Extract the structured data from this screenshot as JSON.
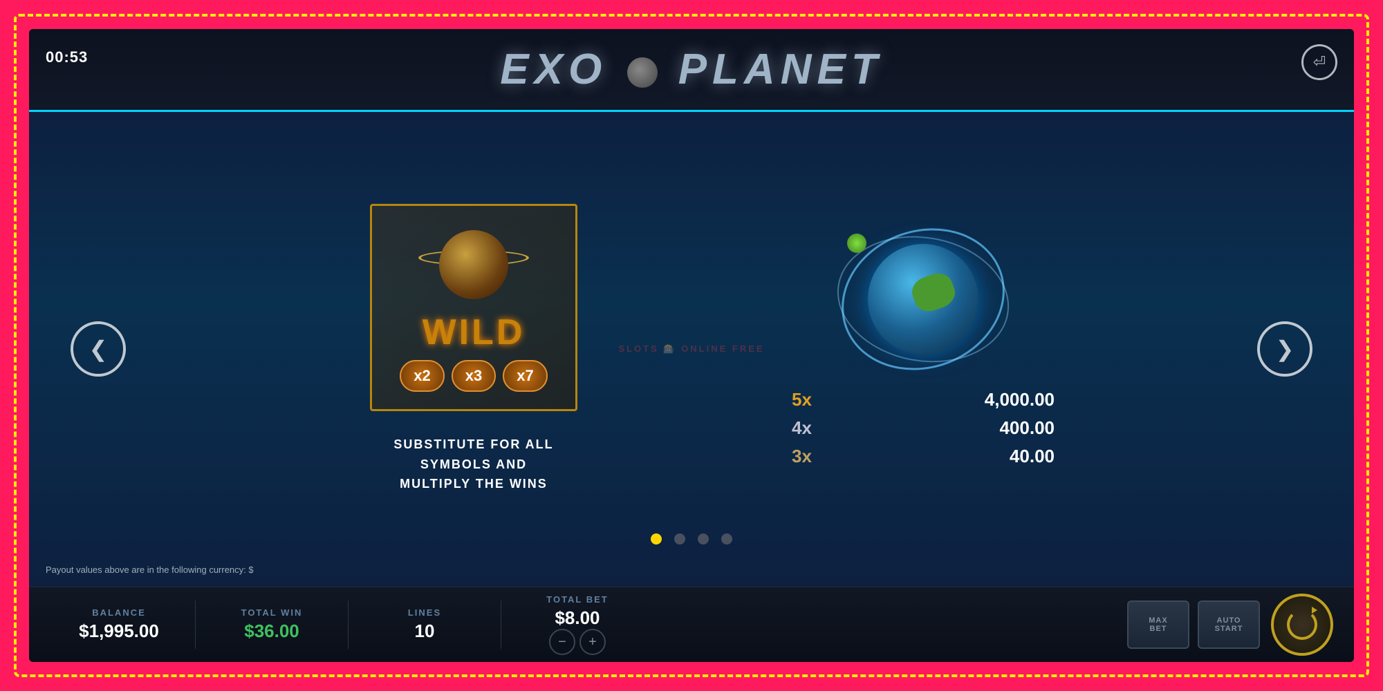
{
  "outer": {
    "border_color": "#ff1a5e",
    "dash_color": "#ffee00"
  },
  "header": {
    "timer": "00:53",
    "title": "EXO PLANET",
    "back_label": "⏎"
  },
  "wild_panel": {
    "symbol_label": "WILD",
    "multipliers": [
      "x2",
      "x3",
      "x7"
    ],
    "description": "SUBSTITUTE FOR ALL\nSYMBOLS AND\nMULTIPLY THE WINS"
  },
  "watermark": {
    "text": "SLOTS 🎰 ONLINE FREE"
  },
  "planet_panel": {
    "payouts": [
      {
        "mult": "5x",
        "value": "4,000.00",
        "color": "gold"
      },
      {
        "mult": "4x",
        "value": "400.00",
        "color": "silver"
      },
      {
        "mult": "3x",
        "value": "40.00",
        "color": "bronze"
      }
    ]
  },
  "pagination": {
    "dots": 4,
    "active": 0
  },
  "footer_note": "Payout values above are in the following currency: $",
  "bottom_bar": {
    "balance_label": "BALANCE",
    "balance_value": "$1,995.00",
    "total_win_label": "TOTAL WIN",
    "total_win_value": "$36.00",
    "lines_label": "LINES",
    "lines_value": "10",
    "total_bet_label": "TOTAL BET",
    "total_bet_value": "$8.00",
    "max_bet_label": "MAX\nBET",
    "auto_start_label": "AUTO\nSTART"
  },
  "nav": {
    "left_arrow": "❮",
    "right_arrow": "❯"
  }
}
